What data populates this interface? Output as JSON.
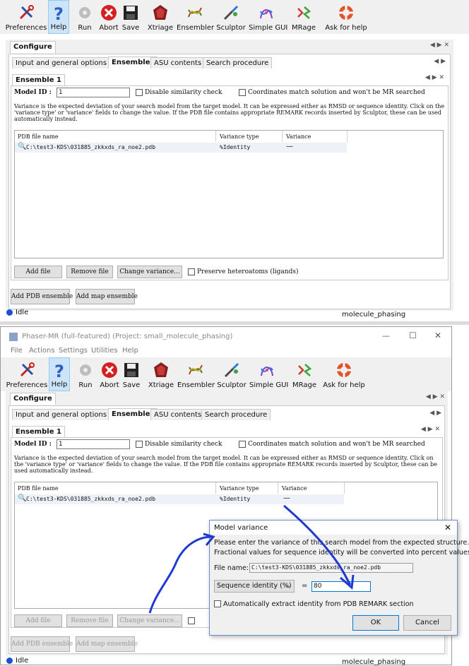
{
  "toolbar": {
    "items": [
      {
        "label": "Preferences",
        "icon": "wrench-screwdriver-icon"
      },
      {
        "label": "Help",
        "icon": "question-icon"
      },
      {
        "label": "Run",
        "icon": "gear-icon"
      },
      {
        "label": "Abort",
        "icon": "abort-icon"
      },
      {
        "label": "Save",
        "icon": "floppy-icon"
      },
      {
        "label": "Xtriage",
        "icon": "xtriage-icon"
      },
      {
        "label": "Ensembler",
        "icon": "ensembler-icon"
      },
      {
        "label": "Sculptor",
        "icon": "sculptor-icon"
      },
      {
        "label": "Simple GUI",
        "icon": "simple-gui-icon"
      },
      {
        "label": "MRage",
        "icon": "mrage-icon"
      },
      {
        "label": "Ask for help",
        "icon": "lifebuoy-icon"
      }
    ]
  },
  "window": {
    "title": "Phaser-MR (full-featured) (Project: small_molecule_phasing)",
    "menu": [
      "File",
      "Actions",
      "Settings",
      "Utilities",
      "Help"
    ],
    "minimize": "—",
    "maximize": "☐",
    "close": "✕"
  },
  "configure": {
    "tab": "Configure"
  },
  "tabs": [
    "Input and general options",
    "Ensembles",
    "ASU contents",
    "Search procedure"
  ],
  "ensemble": {
    "tab": "Ensemble 1",
    "model_id_label": "Model ID :",
    "model_id_value": "1",
    "disable_similarity": "Disable similarity check",
    "coordinates_match": "Coordinates match solution and won't be MR searched",
    "description": "Variance is the expected deviation of your search model from the target model. It can be expressed either as RMSD or sequence identity. Click on the 'variance type' or 'variance' fields to change the value.  If the PDB file contains appropriate REMARK records inserted by Sculptor, these can be used automatically instead.",
    "columns": [
      "PDB file name",
      "Variance type",
      "Variance"
    ],
    "row": {
      "file": "C:\\test3-KDS\\031885_zkkxds_ra_noe2.pdb",
      "type": "%Identity",
      "variance": "—"
    },
    "add_file": "Add file",
    "remove_file": "Remove file",
    "change_variance": "Change variance...",
    "preserve": "Preserve heteroatoms (ligands)",
    "add_pdb": "Add PDB ensemble",
    "add_map": "Add map ensemble"
  },
  "status": {
    "text": "Idle",
    "right": "molecule_phasing"
  },
  "dialog": {
    "title": "Model variance",
    "line1": "Please enter the variance of this search model from the expected structure.",
    "line2": "Fractional values for sequence identity will be converted into percent values.",
    "file_label": "File name:",
    "file_value": "C:\\test3-KDS\\031885_zkkxds_ra_noe2.pdb",
    "select_value": "Sequence identity (%)",
    "equals": "=",
    "input_value": "80",
    "auto_extract": "Automatically extract identity from PDB REMARK section",
    "ok": "OK",
    "cancel": "Cancel"
  },
  "colors": {
    "accent": "#0078d7",
    "arrow": "#1f3ad0"
  }
}
